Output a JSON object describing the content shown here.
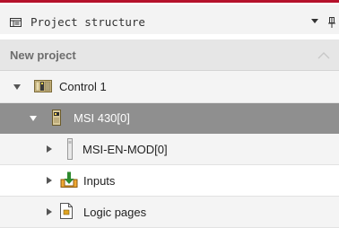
{
  "panel": {
    "title": "Project structure",
    "icons": {
      "panel": "panel-icon",
      "menu": "dropdown-arrow-icon",
      "pin": "pin-icon"
    }
  },
  "group": {
    "title": "New project",
    "icon": "collapse-chevron-icon"
  },
  "tree": [
    {
      "label": "Control 1",
      "expanded": true,
      "selected": false,
      "icon": "controller-icon"
    },
    {
      "label": "MSI 430[0]",
      "expanded": true,
      "selected": true,
      "icon": "module-icon"
    },
    {
      "label": "MSI-EN-MOD[0]",
      "expanded": false,
      "selected": false,
      "icon": "expansion-module-icon"
    },
    {
      "label": "Inputs",
      "expanded": false,
      "selected": false,
      "icon": "inputs-icon"
    },
    {
      "label": "Logic pages",
      "expanded": false,
      "selected": false,
      "icon": "logic-page-icon"
    }
  ],
  "colors": {
    "accent": "#b5112b",
    "selected_row": "#8f8f8f",
    "header_bg": "#e6e6e6"
  }
}
